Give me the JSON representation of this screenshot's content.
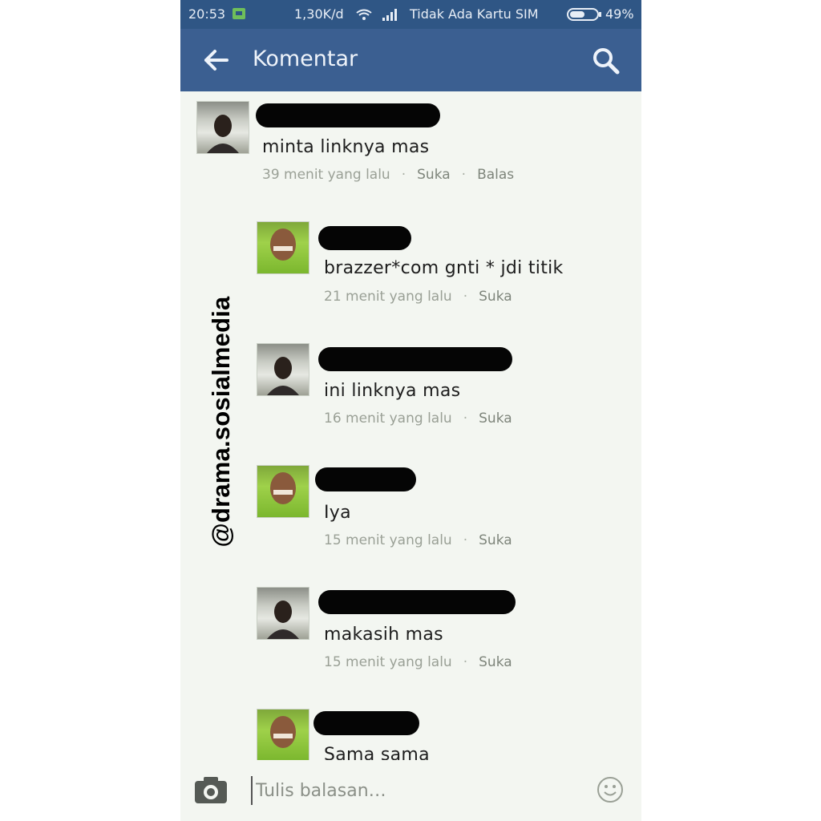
{
  "status_bar": {
    "time": "20:53",
    "speed": "1,30K/d",
    "carrier": "Tidak Ada Kartu SIM",
    "battery": "49%"
  },
  "header": {
    "title": "Komentar"
  },
  "comments": [
    {
      "text": "minta linknya mas",
      "time": "39 menit yang lalu",
      "like": "Suka",
      "reply": "Balas"
    },
    {
      "text": "brazzer*com gnti * jdi titik",
      "time": "21 menit yang lalu",
      "like": "Suka"
    },
    {
      "text": "ini linknya mas",
      "time": "16 menit yang lalu",
      "like": "Suka"
    },
    {
      "text": "Iya",
      "time": "15 menit yang lalu",
      "like": "Suka"
    },
    {
      "text": "makasih mas",
      "time": "15 menit yang lalu",
      "like": "Suka"
    },
    {
      "text": "Sama sama"
    }
  ],
  "reply_bar": {
    "placeholder": "Tulis balasan…"
  },
  "watermark": "@drama.sosialmedia",
  "colors": {
    "app_bar": "#3b5f91",
    "status_bar": "#2f5685",
    "background": "#f3f6f1"
  },
  "icons": [
    "back-arrow-icon",
    "search-icon",
    "camera-icon",
    "emoji-icon",
    "wifi-icon",
    "signal-icon",
    "battery-icon",
    "sms-icon"
  ]
}
